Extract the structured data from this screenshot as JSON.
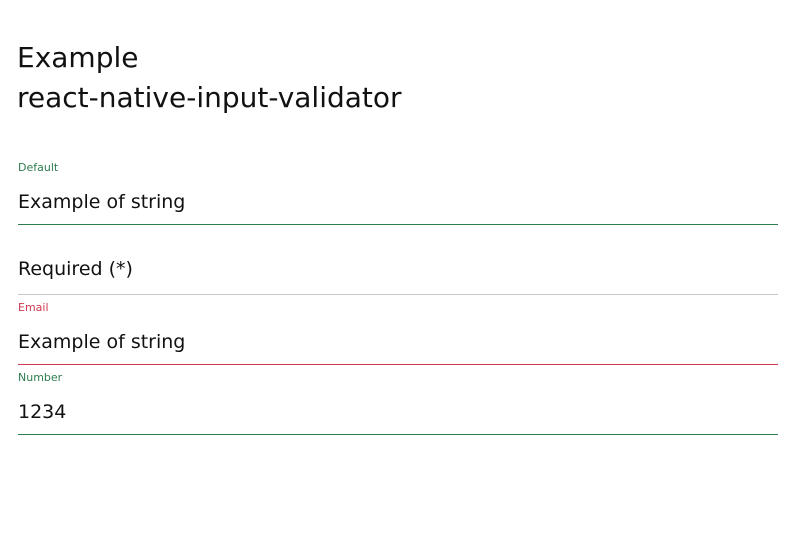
{
  "header": {
    "title_line1": "Example",
    "title_line2": "react-native-input-validator"
  },
  "fields": [
    {
      "label": "Default",
      "value": "Example of string",
      "status": "valid"
    },
    {
      "label": "",
      "value": "",
      "placeholder": "Required (*)",
      "status": "neutral"
    },
    {
      "label": "Email",
      "value": "Example of string",
      "status": "invalid"
    },
    {
      "label": "Number",
      "value": "1234",
      "status": "valid"
    }
  ],
  "colors": {
    "valid": "#2e7d4f",
    "invalid": "#d0394f",
    "neutral": "#c8c8c8",
    "placeholder": "#b3b3b3"
  }
}
